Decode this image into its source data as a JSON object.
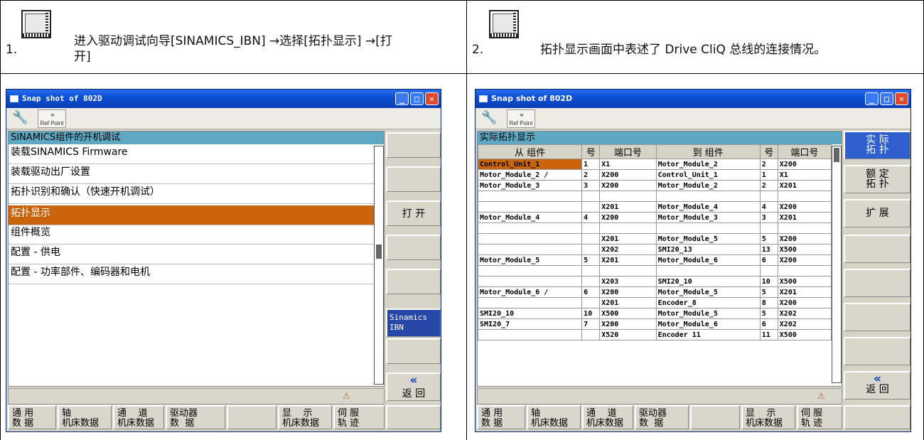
{
  "step1": {
    "number": "1.",
    "line1": "进入驱动调试向导[SINAMICS_IBN] →选择[拓扑显示] →[打",
    "line2": "开]"
  },
  "step2": {
    "number": "2.",
    "text": "拓扑显示画面中表述了 Drive CliQ 总线的连接情况。"
  },
  "win1": {
    "title": "Snap shot of 802D",
    "refpoint": "Ref Point",
    "panel_title": "SINAMICS组件的开机调试",
    "items": [
      "装载SINAMICS Firmware",
      "装载驱动出厂设置",
      "拓扑识别和确认（快速开机调试）",
      "拓扑显示",
      "组件概览",
      "配置 - 供电",
      "配置 - 功率部件、编码器和电机"
    ],
    "selected_index": 3,
    "softkeys": {
      "open": "打 开",
      "sinamics_ibn_1": "Sinamics",
      "sinamics_ibn_2": "IBN",
      "back_arrow": "«",
      "back": "返 回"
    },
    "hsoftkeys": [
      "通 用\n数 据",
      "轴\n机床数据",
      "通    道\n机床数据",
      "驱动器\n数  据",
      "",
      "显    示\n机床数据",
      "伺 服\n轨 迹",
      ""
    ]
  },
  "win2": {
    "title": "Snap shot of 802D",
    "refpoint": "Ref Point",
    "panel_title": "实际拓扑显示",
    "columns": [
      "从 组件",
      "号",
      "端口号",
      "到 组件",
      "号",
      "端口号"
    ],
    "rows": [
      [
        "Control_Unit_1",
        "1",
        "X1",
        "Motor_Module_2",
        "2",
        "X200"
      ],
      [
        "Motor_Module_2 /",
        "2",
        "X200",
        "Control_Unit_1",
        "1",
        "X1"
      ],
      [
        "Motor_Module_3",
        "3",
        "X200",
        "Motor_Module_2",
        "2",
        "X201"
      ],
      [
        "",
        "",
        "",
        "",
        "",
        ""
      ],
      [
        "",
        "",
        "X201",
        "Motor_Module_4",
        "4",
        "X200"
      ],
      [
        "Motor_Module_4",
        "4",
        "X200",
        "Motor_Module_3",
        "3",
        "X201"
      ],
      [
        "",
        "",
        "",
        "",
        "",
        ""
      ],
      [
        "",
        "",
        "X201",
        "Motor_Module_5",
        "5",
        "X200"
      ],
      [
        "",
        "",
        "X202",
        "SMI20_13",
        "13",
        "X500"
      ],
      [
        "Motor_Module_5",
        "5",
        "X201",
        "Motor_Module_6",
        "6",
        "X200"
      ],
      [
        "",
        "",
        "",
        "",
        "",
        ""
      ],
      [
        "",
        "",
        "X203",
        "SMI20_10",
        "10",
        "X500"
      ],
      [
        "Motor_Module_6 /",
        "6",
        "X200",
        "Motor_Module_5",
        "5",
        "X201"
      ],
      [
        "",
        "",
        "X201",
        "Encoder_8",
        "8",
        "X200"
      ],
      [
        "SMI20_10",
        "10",
        "X500",
        "Motor_Module_5",
        "5",
        "X202"
      ],
      [
        "SMI20_7",
        "7",
        "X200",
        "Motor_Module_6",
        "6",
        "X202"
      ],
      [
        "",
        "",
        "X520",
        "Encoder 11",
        "11",
        "X500"
      ]
    ],
    "softkeys": {
      "actual1": "实 际",
      "actual2": "拓 扑",
      "rated1": "额 定",
      "rated2": "拓 扑",
      "expand": "扩 展",
      "back_arrow": "«",
      "back": "返 回"
    },
    "hsoftkeys": [
      "通 用\n数 据",
      "轴\n机床数据",
      "通    道\n机床数据",
      "驱动器\n数  据",
      "",
      "显    示\n机床数据",
      "伺 服\n轨 迹",
      ""
    ]
  }
}
